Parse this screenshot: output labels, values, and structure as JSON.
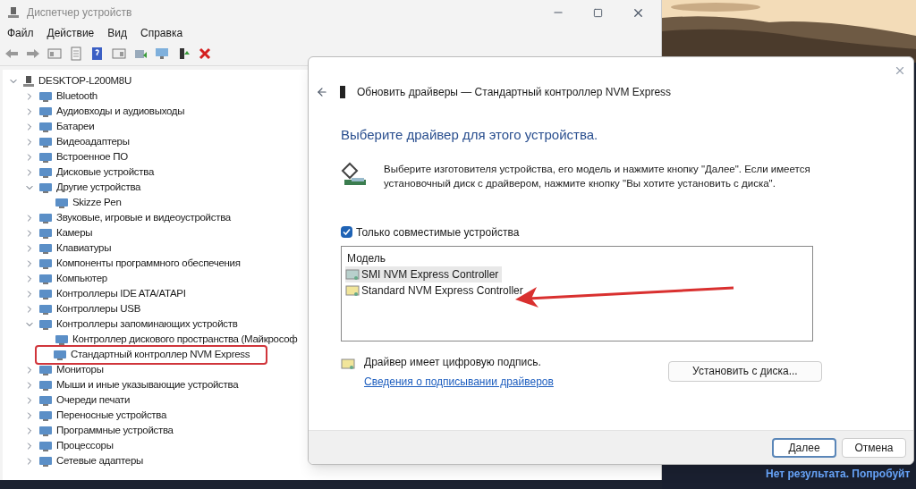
{
  "window": {
    "title": "Диспетчер устройств"
  },
  "menu": [
    "Файл",
    "Действие",
    "Вид",
    "Справка"
  ],
  "tree": {
    "label": "DESKTOP-L200M8U",
    "expanded": true,
    "children": [
      {
        "label": "Bluetooth",
        "expanded": false
      },
      {
        "label": "Аудиовходы и аудиовыходы",
        "expanded": false
      },
      {
        "label": "Батареи",
        "expanded": false
      },
      {
        "label": "Видеоадаптеры",
        "expanded": false
      },
      {
        "label": "Встроенное ПО",
        "expanded": false
      },
      {
        "label": "Дисковые устройства",
        "expanded": false
      },
      {
        "label": "Другие устройства",
        "expanded": true,
        "children": [
          {
            "label": "Skizze Pen",
            "annotated": false
          }
        ]
      },
      {
        "label": "Звуковые, игровые и видеоустройства",
        "expanded": false
      },
      {
        "label": "Камеры",
        "expanded": false
      },
      {
        "label": "Клавиатуры",
        "expanded": false
      },
      {
        "label": "Компоненты программного обеспечения",
        "expanded": false
      },
      {
        "label": "Компьютер",
        "expanded": false
      },
      {
        "label": "Контроллеры IDE ATA/ATAPI",
        "expanded": false
      },
      {
        "label": "Контроллеры USB",
        "expanded": false
      },
      {
        "label": "Контроллеры запоминающих устройств",
        "expanded": true,
        "children": [
          {
            "label": "Контроллер дискового пространства (Майкрософ",
            "annotated": false
          },
          {
            "label": "Стандартный контроллер NVM Express",
            "annotated": true
          }
        ]
      },
      {
        "label": "Мониторы",
        "expanded": false
      },
      {
        "label": "Мыши и иные указывающие устройства",
        "expanded": false
      },
      {
        "label": "Очереди печати",
        "expanded": false
      },
      {
        "label": "Переносные устройства",
        "expanded": false
      },
      {
        "label": "Программные устройства",
        "expanded": false
      },
      {
        "label": "Процессоры",
        "expanded": false
      },
      {
        "label": "Сетевые адаптеры",
        "expanded": false
      }
    ]
  },
  "dialog": {
    "title": "Обновить драйверы — Стандартный контроллер NVM Express",
    "heading": "Выберите драйвер для этого устройства.",
    "description": "Выберите изготовителя устройства, его модель и нажмите кнопку \"Далее\". Если имеется установочный диск с драйвером, нажмите кнопку \"Вы хотите установить с диска\".",
    "compatible": {
      "label": "Только совместимые устройства",
      "checked": true
    },
    "list_header": "Модель",
    "models": [
      {
        "label": "SMI NVM Express Controller",
        "selected": true
      },
      {
        "label": "Standard NVM Express Controller",
        "selected": false
      }
    ],
    "signed": "Драйвер имеет цифровую подпись.",
    "link": "Сведения о подписывании драйверов",
    "install_button": "Установить с диска...",
    "buttons": [
      "Далее",
      "Отмена"
    ]
  },
  "background_text": "Нет результата. Попробуйт"
}
